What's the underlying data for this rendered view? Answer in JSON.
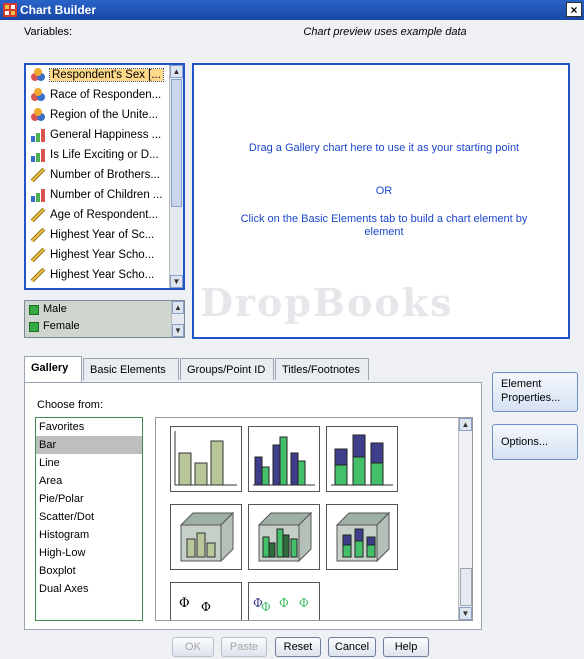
{
  "window": {
    "title": "Chart Builder",
    "close_glyph": "×"
  },
  "variables_label": "Variables:",
  "preview_note": "Chart preview uses example data",
  "variables": [
    {
      "label": "Respondent's Sex [...",
      "icon": "nominal-icon",
      "selected": true
    },
    {
      "label": "Race of Responden...",
      "icon": "nominal-icon"
    },
    {
      "label": "Region of the Unite...",
      "icon": "nominal-icon"
    },
    {
      "label": "General Happiness ...",
      "icon": "ordinal-icon"
    },
    {
      "label": "Is Life Exciting or D...",
      "icon": "ordinal-icon"
    },
    {
      "label": "Number of Brothers...",
      "icon": "scale-icon"
    },
    {
      "label": "Number of Children ...",
      "icon": "ordinal-icon"
    },
    {
      "label": "Age of Respondent...",
      "icon": "scale-icon"
    },
    {
      "label": "Highest Year of Sc...",
      "icon": "scale-icon"
    },
    {
      "label": "Highest Year Scho...",
      "icon": "scale-icon"
    },
    {
      "label": "Highest Year Scho...",
      "icon": "scale-icon"
    }
  ],
  "categories": [
    "Male",
    "Female"
  ],
  "preview": {
    "line1": "Drag a Gallery chart here to use it as your starting point",
    "or": "OR",
    "line2": "Click on the Basic Elements tab to build a chart element by element"
  },
  "tabs": [
    "Gallery",
    "Basic Elements",
    "Groups/Point ID",
    "Titles/Footnotes"
  ],
  "choose_from": "Choose from:",
  "chart_types": [
    "Favorites",
    "Bar",
    "Line",
    "Area",
    "Pie/Polar",
    "Scatter/Dot",
    "Histogram",
    "High-Low",
    "Boxplot",
    "Dual Axes"
  ],
  "selected_chart_type": "Bar",
  "side_buttons": {
    "element_properties": "Element Properties...",
    "options": "Options..."
  },
  "buttons": {
    "ok": "OK",
    "paste": "Paste",
    "reset": "Reset",
    "cancel": "Cancel",
    "help": "Help"
  },
  "watermark": "DropBooks",
  "colors": {
    "accent": "#1f55c8",
    "title_bar": "#1f54b8",
    "preview_text": "#1d47c9",
    "bar_olive": "#b7c79a",
    "bar_navy": "#3e3e8a",
    "bar_green": "#44c06a"
  }
}
